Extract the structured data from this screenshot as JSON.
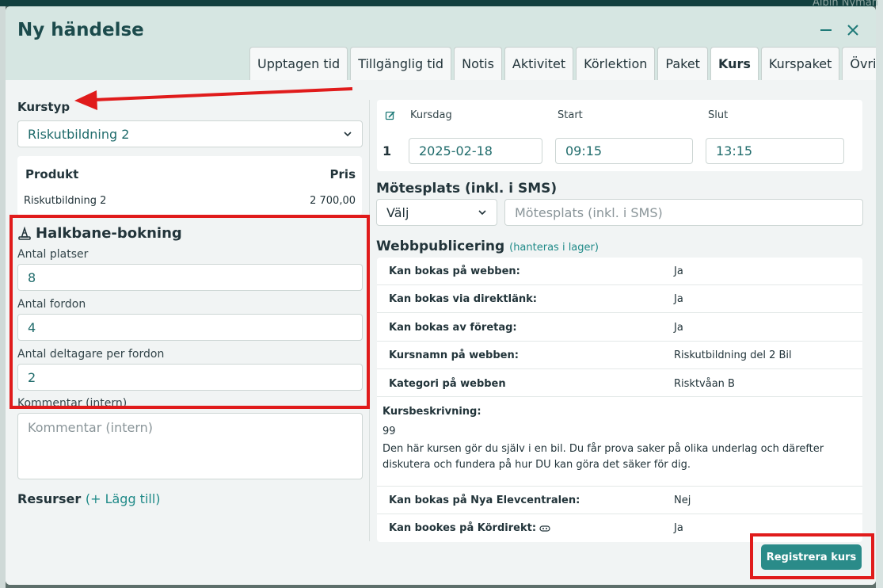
{
  "background": {
    "user_name": "Albin Nyman"
  },
  "dialog": {
    "title": "Ny händelse",
    "tabs": [
      "Upptagen tid",
      "Tillgänglig tid",
      "Notis",
      "Aktivitet",
      "Körlektion",
      "Paket",
      "Kurs",
      "Kurspaket",
      "Övrigt"
    ],
    "active_tab": "Kurs"
  },
  "left": {
    "kurstyp_label": "Kurstyp",
    "kurstyp_value": "Riskutbildning 2",
    "product_header": "Produkt",
    "price_header": "Pris",
    "product_name": "Riskutbildning 2",
    "product_price": "2 700,00",
    "section_title": "Halkbane-bokning",
    "fields": [
      {
        "label": "Antal platser",
        "value": "8"
      },
      {
        "label": "Antal fordon",
        "value": "4"
      },
      {
        "label": "Antal deltagare per fordon",
        "value": "2"
      }
    ],
    "comment_label": "Kommentar (intern)",
    "comment_placeholder": "Kommentar (intern)",
    "resources_label": "Resurser",
    "resources_add": "(+ Lägg till)"
  },
  "schedule": {
    "col_day": "Kursdag",
    "col_start": "Start",
    "col_end": "Slut",
    "row_number": "1",
    "date": "2025-02-18",
    "start": "09:15",
    "end": "13:15"
  },
  "meeting": {
    "title": "Mötesplats (inkl. i SMS)",
    "select_value": "Välj",
    "input_placeholder": "Mötesplats (inkl. i SMS)"
  },
  "web": {
    "title": "Webbpublicering",
    "subtitle": "(hanteras i lager)",
    "rows": [
      {
        "key": "Kan bokas på webben:",
        "value": "Ja"
      },
      {
        "key": "Kan bokas via direktlänk:",
        "value": "Ja"
      },
      {
        "key": "Kan bokas av företag:",
        "value": "Ja"
      },
      {
        "key": "Kursnamn på webben:",
        "value": "Riskutbildning del 2 Bil"
      },
      {
        "key": "Kategori på webben",
        "value": "Risktvåan B"
      }
    ],
    "description_label": "Kursbeskrivning:",
    "description_quote": "99",
    "description_text": "Den här kursen gör du själv i en bil. Du får prova saker på olika underlag och därefter diskutera och fundera på hur DU kan göra det säker för dig.",
    "rows_after": [
      {
        "key": "Kan bokas på Nya Elevcentralen:",
        "value": "Nej"
      },
      {
        "key": "Kan bookes på Kördirekt:",
        "value": "Ja"
      }
    ]
  },
  "register_button": "Registrera kurs",
  "colors": {
    "accent": "#2a8b89",
    "annotation": "#e01b1b",
    "header_bg": "#d6e6e2"
  }
}
